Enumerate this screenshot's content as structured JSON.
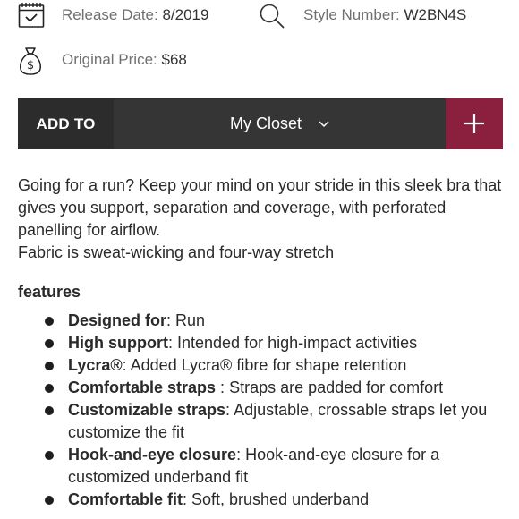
{
  "info": {
    "release_label": "Release Date:",
    "release_value": "8/2019",
    "style_label": "Style Number:",
    "style_value": "W2BN4S",
    "price_label": "Original Price:",
    "price_value": "$68"
  },
  "icons": {
    "calendar": "calendar-check-icon",
    "search": "magnifier-icon",
    "price": "money-bag-icon",
    "dropdown": "chevron-down-icon",
    "add": "plus-icon"
  },
  "add_bar": {
    "add_to_label": "ADD TO",
    "closet_value": "My Closet"
  },
  "description": {
    "paragraph": "Going for a run? Keep your mind on your stride in this sleek bra that gives you support, separation and coverage, with perforated panelling for airflow.",
    "fabric": "Fabric is sweat-wicking and four-way stretch"
  },
  "features": {
    "heading": "features",
    "items": [
      {
        "title": "Designed for",
        "sep": ": ",
        "text": "Run"
      },
      {
        "title": "High support",
        "sep": ": ",
        "text": "Intended for high-impact activities"
      },
      {
        "title": "Lycra®",
        "sep": ": ",
        "text": "Added Lycra® fibre for shape retention"
      },
      {
        "title": "Comfortable straps",
        "sep": " : ",
        "text": "Straps are padded for comfort"
      },
      {
        "title": "Customizable straps",
        "sep": ": ",
        "text": "Adjustable, crossable straps let you customize the fit"
      },
      {
        "title": "Hook-and-eye closure",
        "sep": ": ",
        "text": "Hook-and-eye closure for a customized underband fit"
      },
      {
        "title": "Comfortable fit",
        "sep": ": ",
        "text": "Soft, brushed underband"
      }
    ]
  },
  "colors": {
    "accent": "#8b1f3e",
    "bar_dark": "#2c2c2c",
    "closet_bg": "#353535"
  }
}
